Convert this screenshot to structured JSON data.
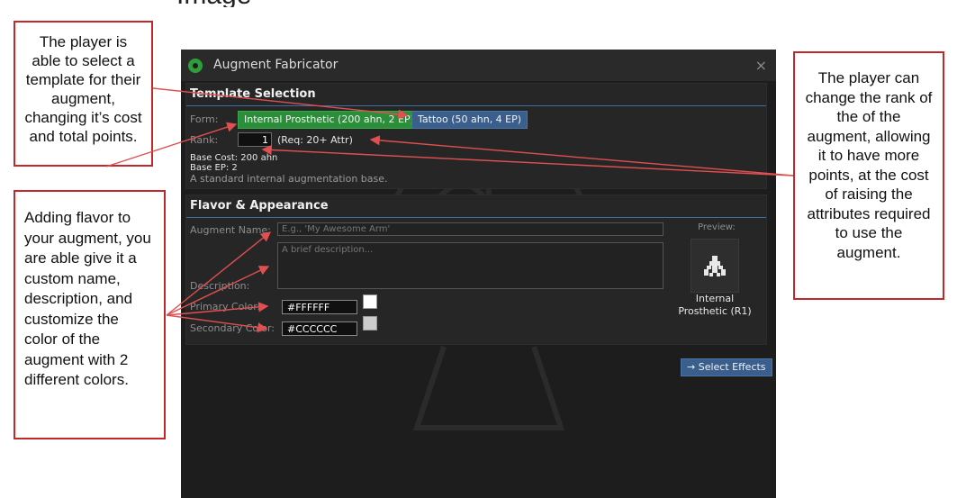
{
  "page_heading": "Image",
  "annotations": {
    "template": "The player is able to select a template for their augment, changing it’s cost and total points.",
    "flavor": "Adding flavor to your augment, you are able give it a custom name, description, and customize the color of the augment with 2 different colors.",
    "rank": "The player can change the rank of the of the augment, allowing it to have more points, at the cost of raising the attributes required to use the augment."
  },
  "window": {
    "title": "Augment Fabricator",
    "close": "×"
  },
  "template_selection": {
    "title": "Template Selection",
    "form_label": "Form:",
    "options": [
      {
        "label": "Internal Prosthetic (200 ahn, 2 EP)"
      },
      {
        "label": "Tattoo (50 ahn, 4 EP)"
      }
    ],
    "rank_label": "Rank:",
    "rank_value": "1",
    "rank_requirement": "(Req: 20+ Attr)",
    "base_cost": "Base Cost: 200 ahn",
    "base_ep": "Base EP: 2",
    "description": "A standard internal augmentation base."
  },
  "flavor": {
    "title": "Flavor & Appearance",
    "name_label": "Augment Name:",
    "name_placeholder": "E.g., 'My Awesome Arm'",
    "description_label": "Description:",
    "description_placeholder": "A brief description...",
    "primary_label": "Primary Color:",
    "primary_value": "#FFFFFF",
    "secondary_label": "Secondary Color:",
    "secondary_value": "#CCCCCC",
    "preview_label": "Preview:",
    "preview_caption_line1": "Internal",
    "preview_caption_line2": "Prosthetic (R1)"
  },
  "actions": {
    "select_effects": "→ Select Effects"
  },
  "colors": {
    "annotation_border": "#c0282a",
    "accent_green": "#2b8f3a",
    "accent_blue": "#3a5f8c",
    "window_bg": "#1d1d1d"
  }
}
